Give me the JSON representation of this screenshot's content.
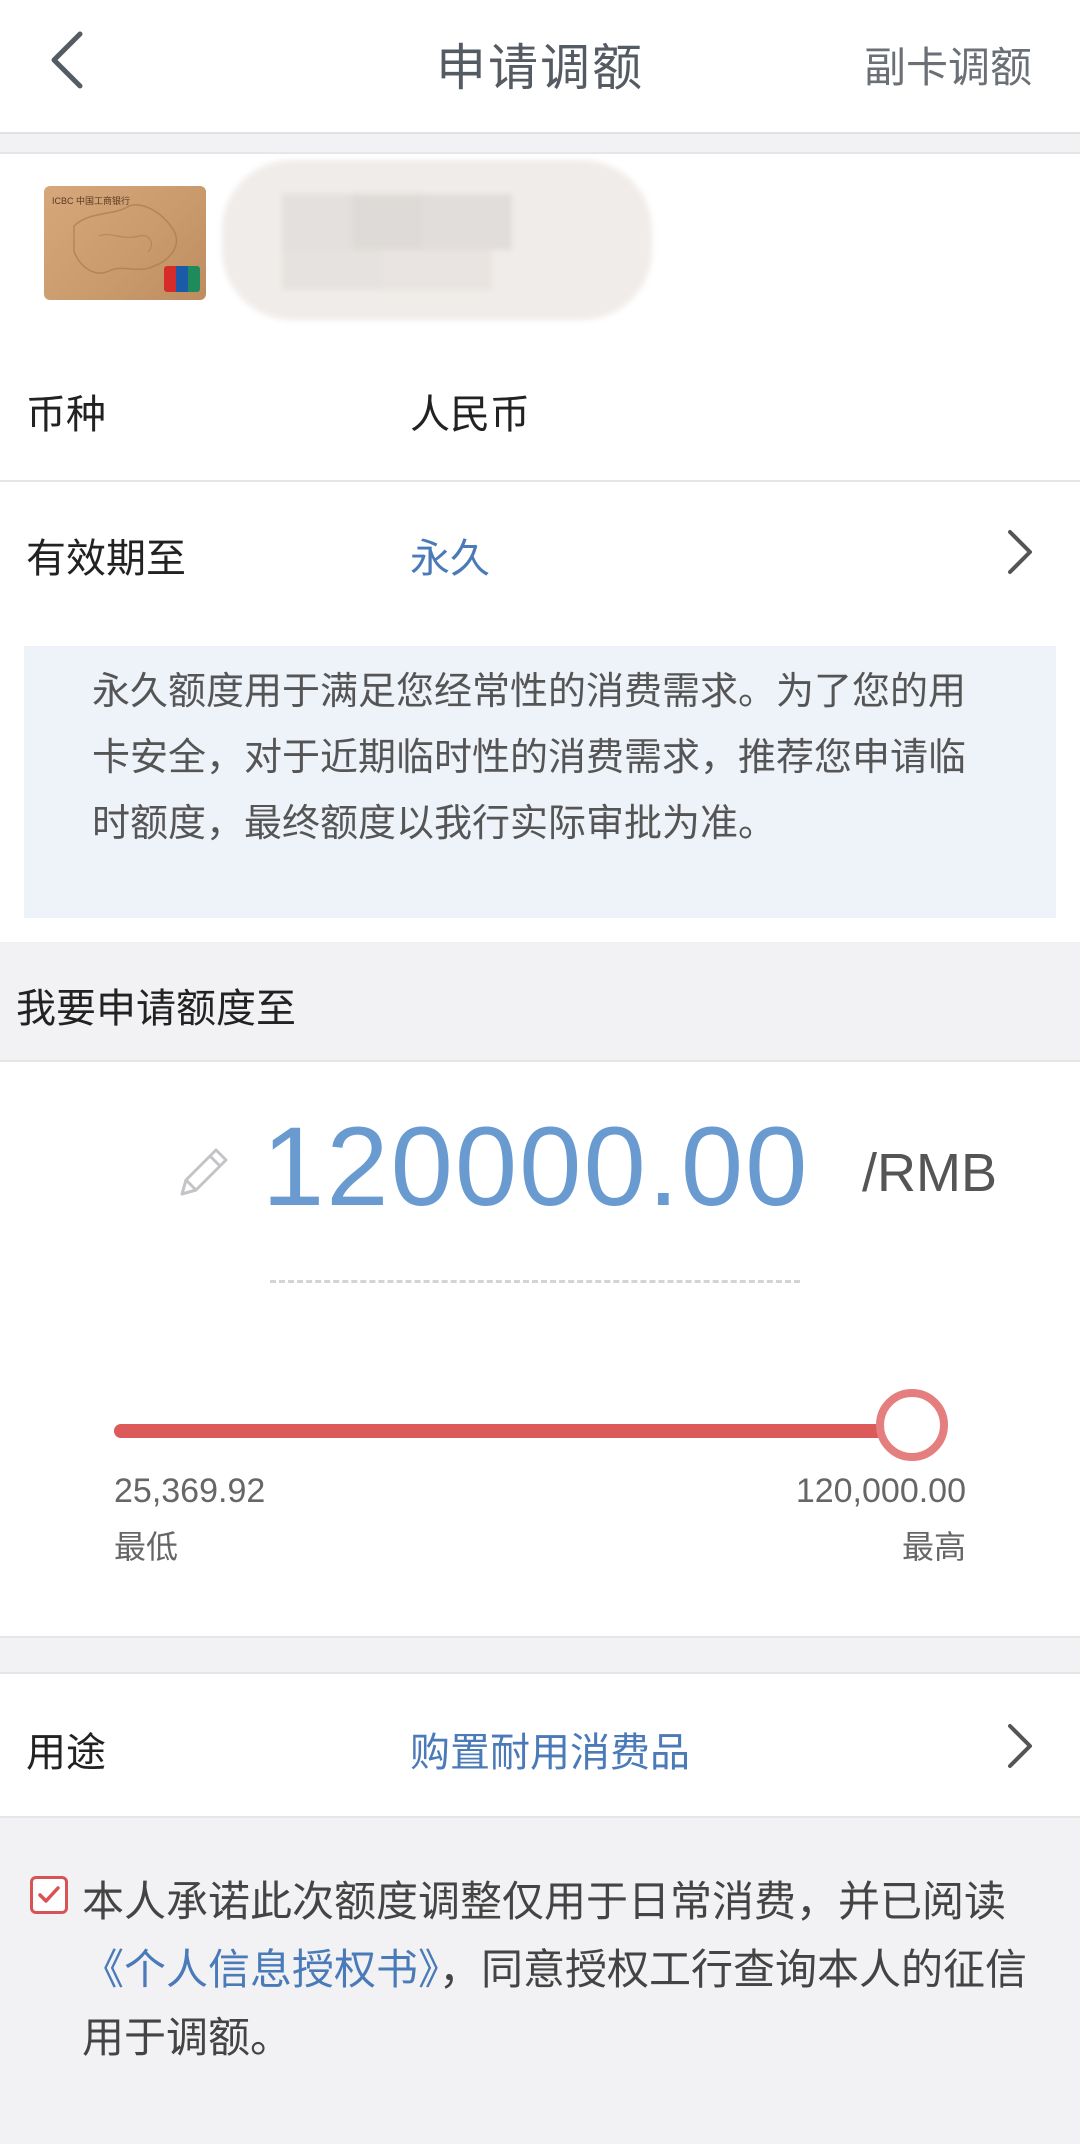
{
  "header": {
    "title": "申请调额",
    "right_link": "副卡调额"
  },
  "card": {
    "brand_text": "ICBC 中国工商银行",
    "number_masked": ""
  },
  "currency": {
    "label": "币种",
    "value": "人民币"
  },
  "validity": {
    "label": "有效期至",
    "value": "永久"
  },
  "notice": {
    "text": "永久额度用于满足您经常性的消费需求。为了您的用卡安全，对于近期临时性的消费需求，推荐您申请临时额度，最终额度以我行实际审批为准。"
  },
  "amount_section": {
    "title": "我要申请额度至",
    "value": "120000.00",
    "unit": "/RMB"
  },
  "slider": {
    "min_value": "25,369.92",
    "min_label": "最低",
    "max_value": "120,000.00",
    "max_label": "最高",
    "current": 120000,
    "min": 25369.92,
    "max": 120000
  },
  "purpose": {
    "label": "用途",
    "value": "购置耐用消费品"
  },
  "agreement": {
    "checked": true,
    "text_before": "本人承诺此次额度调整仅用于日常消费，并已阅读",
    "link": "《个人信息授权书》",
    "text_after": "，同意授权工行查询本人的征信用于调额。"
  },
  "colors": {
    "accent_blue": "#4a7ab8",
    "amount_blue": "#6a9bd0",
    "slider_red": "#dc5a5a",
    "notice_bg": "#eef3fa"
  }
}
